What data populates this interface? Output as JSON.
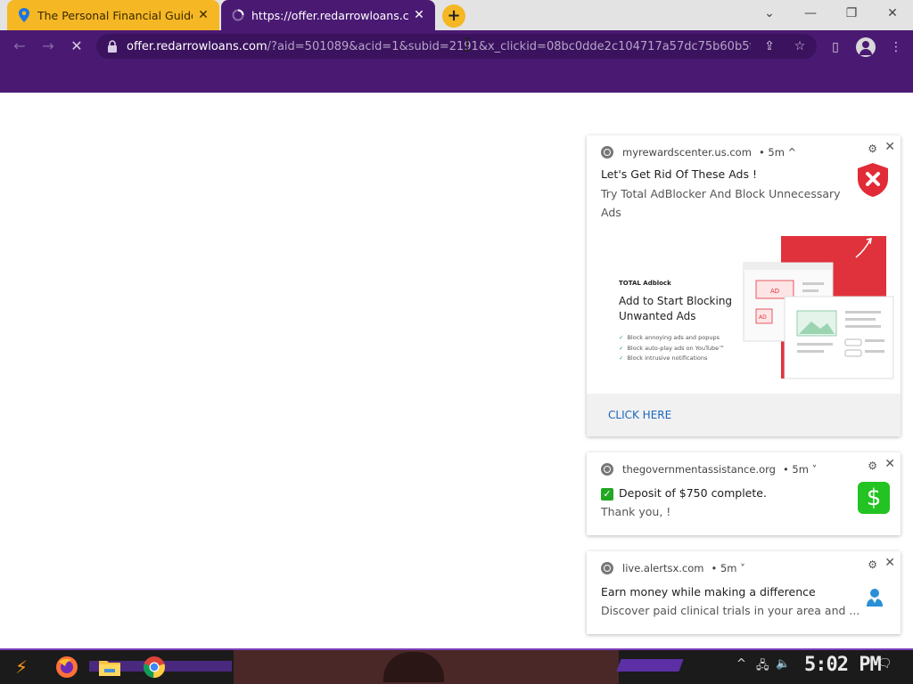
{
  "browser": {
    "tabs": [
      {
        "title": "The Personal Financial Guide",
        "icon": "map-pin-icon"
      },
      {
        "title": "https://offer.redarrowloans.co",
        "icon": "loading-spinner-icon"
      }
    ],
    "new_tab_label": "+",
    "address": {
      "host": "offer.redarrowloans.com",
      "rest": "/?aid=501089&acid=1&subid=2191&x_clickid=08bc0dde2c104717a57dc75b60b5f..."
    },
    "colors": {
      "tab_active": "#4a1a73",
      "tab_inactive": "#f5b724",
      "toolbar": "#4a1a73"
    }
  },
  "notifications": [
    {
      "site": "myrewardscenter.us.com",
      "time": "• 5m ^",
      "title": "Let's Get Rid Of These Ads !",
      "body": "Try Total AdBlocker And Block Unnecessary Ads",
      "icon": "shield-x-icon",
      "promo": {
        "brand": "TOTAL Adblock",
        "headline": "Add to Start Blocking Unwanted Ads",
        "bullets": [
          "Block annoying ads and popups",
          "Block auto-play ads on YouTube™",
          "Block intrusive notifications"
        ],
        "ad_tags": [
          "AD",
          "AD"
        ]
      },
      "action": "CLICK HERE"
    },
    {
      "site": "thegovernmentassistance.org",
      "time": "• 5m ˅",
      "title": "Deposit of $750 complete.",
      "body": "Thank you, !",
      "icon": "dollar-icon"
    },
    {
      "site": "live.alertsx.com",
      "time": "• 5m ˅",
      "title": "Earn money while making a difference",
      "body": "Discover paid clinical trials in your area and ...",
      "icon": "person-icon"
    }
  ],
  "taskbar": {
    "apps": [
      "start-icon",
      "firefox-icon",
      "file-explorer-icon",
      "chrome-icon"
    ],
    "clock": "5:02 PM"
  }
}
